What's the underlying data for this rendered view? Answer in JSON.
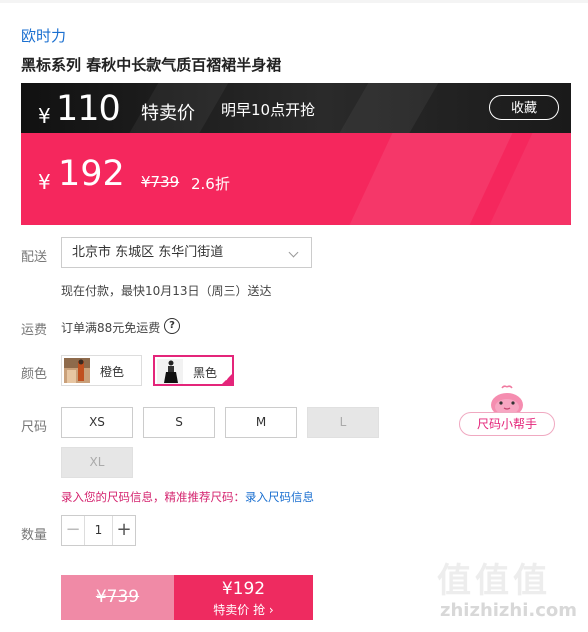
{
  "brand": "欧时力",
  "title": "黑标系列 春秋中长款气质百褶裙半身裙",
  "promo": {
    "yen": "¥",
    "flash_price": "110",
    "flash_label": "特卖价",
    "start_text": "明早10点开抢",
    "favorite_label": "收藏",
    "current_price": "192",
    "original_price": "¥739",
    "discount": "2.6折"
  },
  "delivery": {
    "label": "配送",
    "address": "北京市 东城区 东华门街道",
    "eta": "现在付款，最快10月13日（周三）送达"
  },
  "shipping": {
    "label": "运费",
    "text": "订单满88元免运费",
    "help_icon": "?"
  },
  "color": {
    "label": "颜色",
    "options": [
      {
        "label": "橙色",
        "selected": false
      },
      {
        "label": "黑色",
        "selected": true
      }
    ]
  },
  "size": {
    "label": "尺码",
    "options": [
      {
        "label": "XS",
        "available": true
      },
      {
        "label": "S",
        "available": true
      },
      {
        "label": "M",
        "available": true
      },
      {
        "label": "L",
        "available": false
      },
      {
        "label": "XL",
        "available": false
      }
    ],
    "info_text": "录入您的尺码信息，精准推荐尺码：",
    "info_link": "录入尺码信息",
    "helper_label": "尺码小帮手"
  },
  "quantity": {
    "label": "数量",
    "minus": "−",
    "value": "1",
    "plus": "+"
  },
  "buttons": {
    "original_price": "¥739",
    "sale_price": "¥192",
    "sale_sub": "特卖价 抢 ›"
  },
  "watermark": {
    "chars": "值值值",
    "url": "zhizhizhi.com"
  },
  "colors": {
    "accent_pink": "#f5275d",
    "magenta": "#e4257a",
    "link_blue": "#1a6fd0"
  }
}
